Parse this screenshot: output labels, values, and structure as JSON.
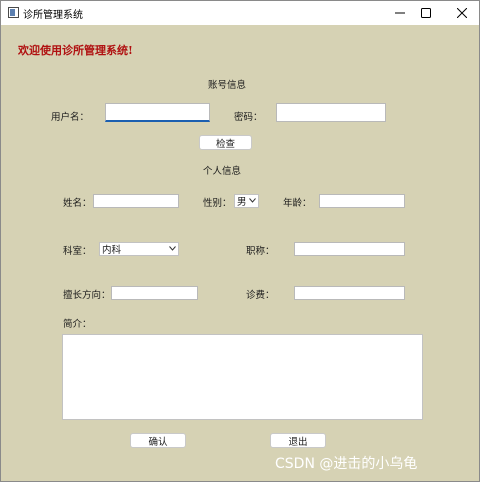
{
  "window": {
    "title": "诊所管理系统"
  },
  "welcome": "欢迎使用诊所管理系统!",
  "account_section": {
    "heading": "账号信息",
    "username_label": "用户名：",
    "username_value": "",
    "password_label": "密码：",
    "password_value": "",
    "check_button": "检查"
  },
  "personal_section": {
    "heading": "个人信息",
    "name_label": "姓名：",
    "name_value": "",
    "gender_label": "性别：",
    "gender_value": "男",
    "age_label": "年龄：",
    "age_value": "",
    "department_label": "科室：",
    "department_value": "内科",
    "title_label": "职称：",
    "title_value": "",
    "specialty_label": "擅长方向：",
    "specialty_value": "",
    "fee_label": "诊费：",
    "fee_value": "",
    "intro_label": "简介：",
    "intro_value": ""
  },
  "actions": {
    "confirm": "确认",
    "exit": "退出"
  },
  "watermark": "CSDN @进击的小乌龟",
  "colors": {
    "background": "#d6d2b4",
    "welcome_text": "#b01010",
    "focus_accent": "#1c5fb0"
  }
}
